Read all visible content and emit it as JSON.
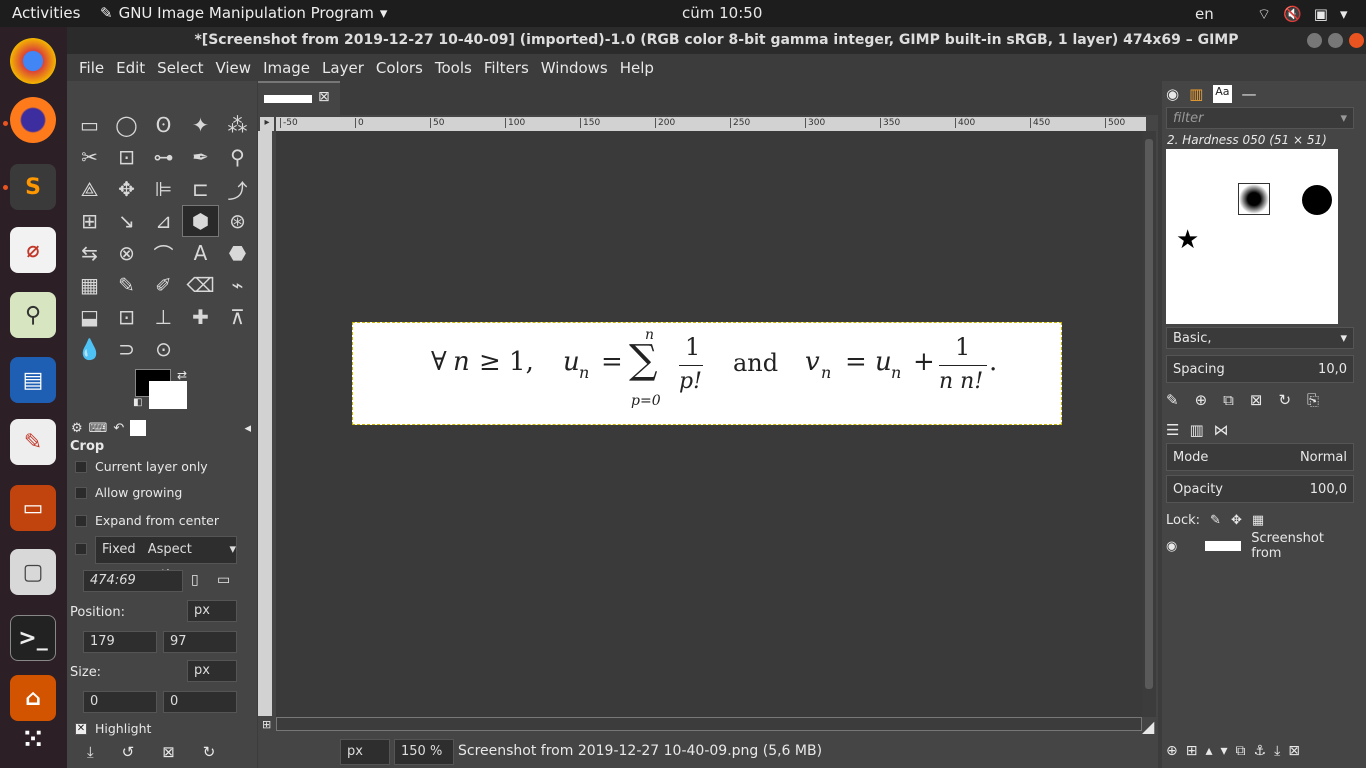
{
  "topbar": {
    "activities": "Activities",
    "app_name": "GNU Image Manipulation Program",
    "clock": "cüm 10:50",
    "lang": "en"
  },
  "window": {
    "title": "*[Screenshot from 2019-12-27 10-40-09] (imported)-1.0 (RGB color 8-bit gamma integer, GIMP built-in sRGB, 1 layer) 474x69 – GIMP"
  },
  "menu": [
    "File",
    "Edit",
    "Select",
    "View",
    "Image",
    "Layer",
    "Colors",
    "Tools",
    "Filters",
    "Windows",
    "Help"
  ],
  "toolbox": {
    "tools": [
      "▭",
      "◯",
      "ʘ",
      "✦",
      "⁂",
      "✂",
      "⊡",
      "⊶",
      "✒",
      "⚲",
      "⟁",
      "✥",
      "⊫",
      "⊏",
      "⤴",
      "⊞",
      "↘",
      "⊿",
      "⬢",
      "⊛",
      "⇆",
      "⊗",
      "⌒",
      "A",
      "⬣",
      "▦",
      "✎",
      "✐",
      "⌫",
      "⌁",
      "⬓",
      "⊡",
      "⊥",
      "✚",
      "⊼",
      "💧",
      "⊃",
      "⊙"
    ],
    "options_title": "Crop",
    "current_layer_only": "Current layer only",
    "allow_growing": "Allow growing",
    "expand_from_center": "Expand from center",
    "fixed": "Fixed",
    "aspect_ratio": "Aspect ratio",
    "ratio_value": "474:69",
    "position_label": "Position:",
    "position_unit": "px",
    "pos_x": "179",
    "pos_y": "97",
    "size_label": "Size:",
    "size_unit": "px",
    "size_w": "0",
    "size_h": "0",
    "highlight": "Highlight"
  },
  "ruler": {
    "ticks": [
      "-50",
      "0",
      "50",
      "100",
      "150",
      "200",
      "250",
      "300",
      "350",
      "400",
      "450",
      "500"
    ]
  },
  "formula": {
    "forall": "∀",
    "n": "n",
    "geq1": "≥ 1,",
    "u": "u",
    "eq": "=",
    "sum": "∑",
    "upper": "n",
    "lower": "p=0",
    "one": "1",
    "pfact": "p!",
    "and": "and",
    "v": "v",
    "plus": "+",
    "den": "n n!",
    "period": "."
  },
  "status": {
    "unit": "px",
    "zoom": "150 %",
    "filename": "Screenshot from 2019-12-27 10-40-09.png (5,6 MB)"
  },
  "rightpanel": {
    "filter_placeholder": "filter",
    "brush_name": "2. Hardness 050 (51 × 51)",
    "preset": "Basic,",
    "spacing_label": "Spacing",
    "spacing_value": "10,0",
    "mode_label": "Mode",
    "mode_value": "Normal",
    "opacity_label": "Opacity",
    "opacity_value": "100,0",
    "lock_label": "Lock:",
    "layer_name": "Screenshot from"
  }
}
